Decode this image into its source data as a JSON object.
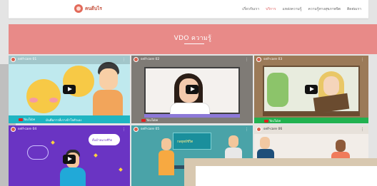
{
  "site": {
    "logo_text": "คนดีบไร",
    "brand_color": "#e26a5a"
  },
  "nav": {
    "items": [
      {
        "label": "เกี่ยวกับเรา",
        "active": false
      },
      {
        "label": "บริการ",
        "active": true
      },
      {
        "label": "แหล่งความรู้",
        "active": false
      },
      {
        "label": "ความรู้ทางสุขภาพจิต",
        "active": false
      },
      {
        "label": "ติดต่อเรา",
        "active": false
      }
    ],
    "active_color": "#e06666"
  },
  "banner": {
    "title": "VDO ความรู้",
    "color": "#e88a88"
  },
  "videos": [
    {
      "title": "self-care 01",
      "caption": "มันคือการที่เราเข้าใจตัวเอง",
      "platform": "YouTube"
    },
    {
      "title": "self-care 02",
      "caption": "",
      "platform": "YouTube"
    },
    {
      "title": "self-care 03",
      "caption": "",
      "platform": "YouTube"
    },
    {
      "title": "self-care 04",
      "caption": "",
      "bubble": "ตั้งเป้าหมายชีวิต",
      "platform": ""
    },
    {
      "title": "self-care 05",
      "caption": "",
      "sign": "กลยุทธ์ชีวิต",
      "platform": ""
    },
    {
      "title": "self-care 06",
      "caption": "",
      "platform": ""
    }
  ],
  "icons": {
    "play": "play-icon",
    "channel": "channel-avatar-icon",
    "more": "more-options-icon"
  }
}
